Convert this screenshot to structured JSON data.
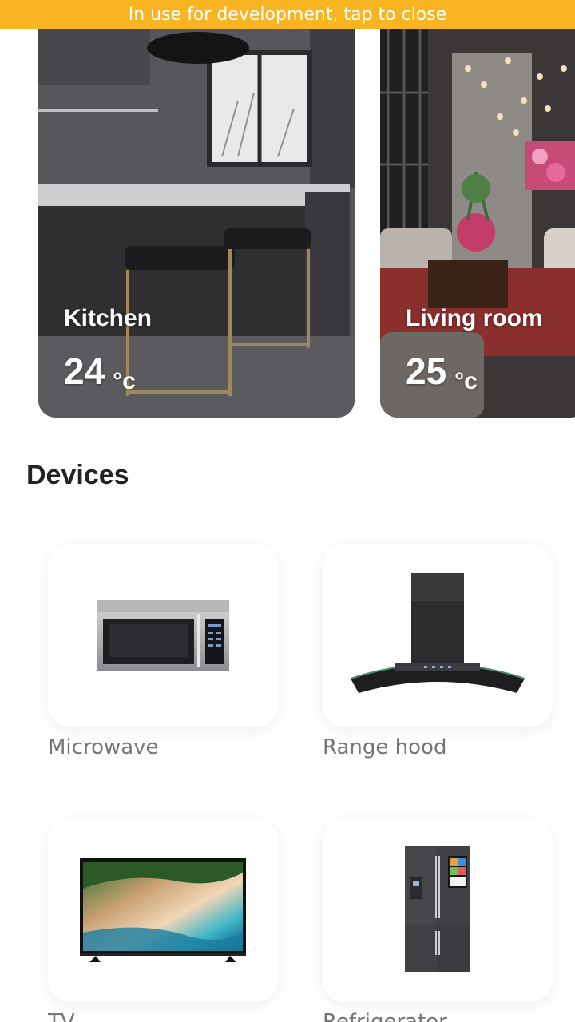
{
  "banner": {
    "text": "In use for development, tap to close"
  },
  "rooms": [
    {
      "name": "Kitchen",
      "temperature": "24",
      "unit": "°c"
    },
    {
      "name": "Living room",
      "temperature": "25",
      "unit": "°c"
    }
  ],
  "devices_section": {
    "title": "Devices"
  },
  "devices": [
    {
      "label": "Microwave",
      "icon": "microwave-icon"
    },
    {
      "label": "Range hood",
      "icon": "range-hood-icon"
    },
    {
      "label": "TV",
      "icon": "tv-icon"
    },
    {
      "label": "Refrigerator",
      "icon": "refrigerator-icon"
    }
  ]
}
